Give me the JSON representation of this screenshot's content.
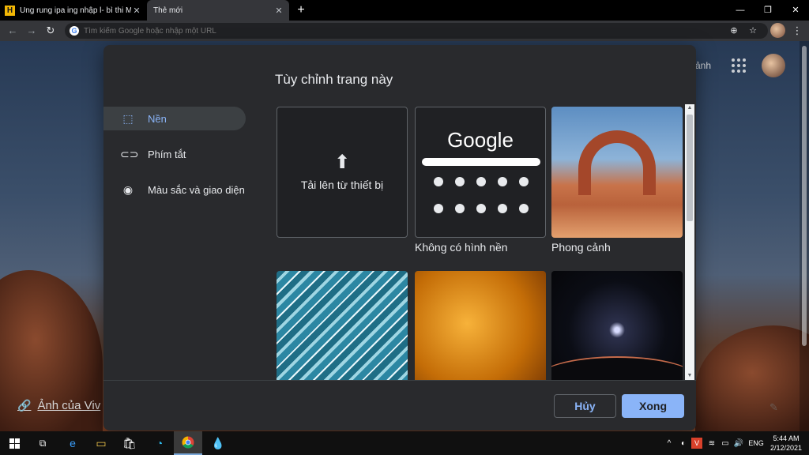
{
  "tabs": [
    {
      "label": "Ung rung ipa ing nhập l- bì thi M",
      "close": "✕"
    },
    {
      "label": "Thẻ mới",
      "close": "✕"
    }
  ],
  "window": {
    "new_tab": "+",
    "minimize": "—",
    "restore": "❐",
    "close": "✕"
  },
  "toolbar": {
    "back": "←",
    "forward": "→",
    "reload": "↻",
    "omnibox_placeholder": "Tìm kiếm Google hoặc nhập một URL",
    "zoom": "⊕",
    "star": "☆",
    "menu": "⋮"
  },
  "ntp": {
    "photo_credit": "Ảnh của Viv",
    "header_partial": "ảnh"
  },
  "dialog": {
    "title": "Tùy chỉnh trang này",
    "menu": [
      {
        "label": "Nền",
        "active": true
      },
      {
        "label": "Phím tắt",
        "active": false
      },
      {
        "label": "Màu sắc và giao diện",
        "active": false
      }
    ],
    "upload_label": "Tải lên từ thiết bị",
    "none_logo": "Google",
    "captions": [
      "Không có hình nền",
      "Phong cảnh"
    ],
    "cancel": "Hủy",
    "done": "Xong"
  },
  "taskbar": {
    "tray_lang": "ENG",
    "time": "5:44 AM",
    "date": "2/12/2021"
  },
  "colors": {
    "accent": "#8ab4f8",
    "dialog_bg": "#292a2d",
    "page_bg": "#202124"
  }
}
